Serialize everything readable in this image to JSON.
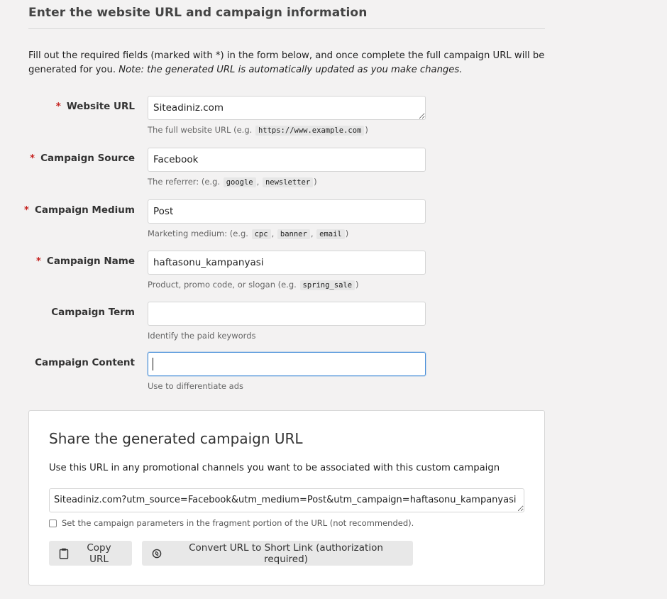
{
  "header": {
    "title": "Enter the website URL and campaign information"
  },
  "intro": {
    "text_main": "Fill out the required fields (marked with *) in the form below, and once complete the full campaign URL will be generated for you. ",
    "text_note": "Note: the generated URL is automatically updated as you make changes."
  },
  "form": {
    "required_mark": "*",
    "website_url": {
      "label": "Website URL",
      "value": "Siteadiniz.com",
      "help_prefix": "The full website URL (e.g. ",
      "help_code": "https://www.example.com",
      "help_suffix": ")"
    },
    "campaign_source": {
      "label": "Campaign Source",
      "value": "Facebook",
      "help_prefix": "The referrer: (e.g. ",
      "help_code_1": "google",
      "help_sep": ",",
      "help_code_2": "newsletter",
      "help_suffix": ")"
    },
    "campaign_medium": {
      "label": "Campaign Medium",
      "value": "Post",
      "help_prefix": "Marketing medium: (e.g. ",
      "help_code_1": "cpc",
      "help_sep": ",",
      "help_code_2": "banner",
      "help_code_3": "email",
      "help_suffix": ")"
    },
    "campaign_name": {
      "label": "Campaign Name",
      "value": "haftasonu_kampanyasi",
      "help_prefix": "Product, promo code, or slogan (e.g. ",
      "help_code": "spring_sale",
      "help_suffix": ")"
    },
    "campaign_term": {
      "label": "Campaign Term",
      "value": "",
      "help": "Identify the paid keywords"
    },
    "campaign_content": {
      "label": "Campaign Content",
      "value": "",
      "help": "Use to differentiate ads"
    }
  },
  "share": {
    "title": "Share the generated campaign URL",
    "description": "Use this URL in any promotional channels you want to be associated with this custom campaign",
    "generated_url": "Siteadiniz.com?utm_source=Facebook&utm_medium=Post&utm_campaign=haftasonu_kampanyasi",
    "fragment_label": "Set the campaign parameters in the fragment portion of the URL (not recommended).",
    "fragment_checked": false,
    "copy_button_label": "Copy URL",
    "copy_button_icon": "clipboard-icon",
    "short_link_button_label": "Convert URL to Short Link (authorization required)",
    "short_link_button_icon": "link-icon"
  },
  "colors": {
    "background": "#f3f2f2",
    "required": "#c5221f",
    "focus_border": "#4a90d9"
  }
}
